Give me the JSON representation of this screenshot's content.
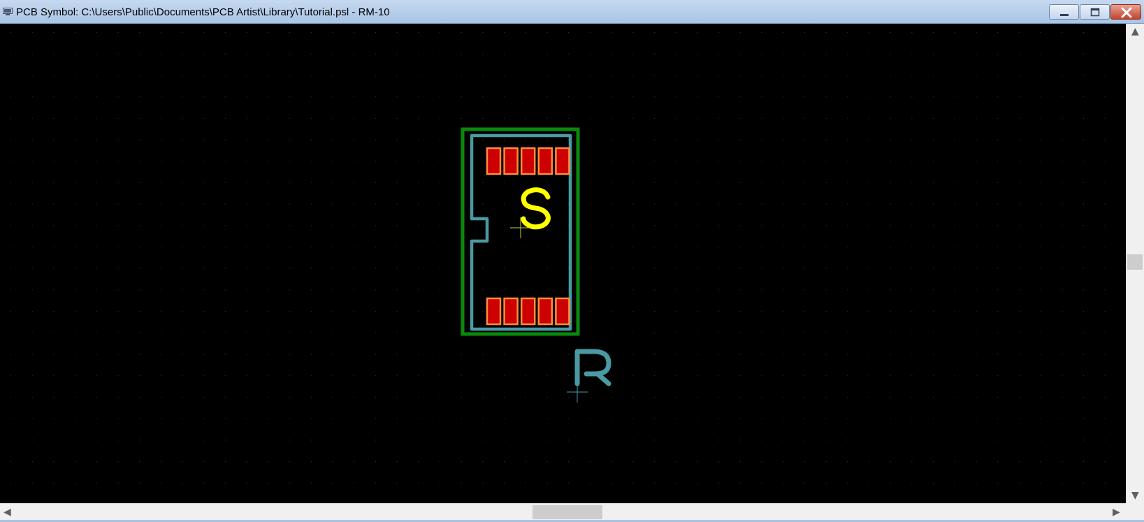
{
  "window": {
    "title": "PCB Symbol: C:\\Users\\Public\\Documents\\PCB Artist\\Library\\Tutorial.psl - RM-10"
  },
  "title_buttons": {
    "minimize_icon": "minimize-icon",
    "maximize_icon": "maximize-icon",
    "close_icon": "close-icon"
  },
  "canvas": {
    "background_color": "#000000",
    "grid_color": "#3a3a3a",
    "component_outline_color": "#0a8a0a",
    "silkscreen_color": "#4a9aa4",
    "pad_fill_color": "#cc0000",
    "pad_border_color": "#ff8c3c",
    "origin_marker_color": "#c8c84a",
    "label_s_color": "#ffff00",
    "label_s_text": "S",
    "label_r_text": "R",
    "top_pad_count": 5,
    "bottom_pad_count": 5
  },
  "scrollbars": {
    "up_arrow": "▲",
    "down_arrow": "▼",
    "left_arrow": "◀",
    "right_arrow": "▶"
  }
}
